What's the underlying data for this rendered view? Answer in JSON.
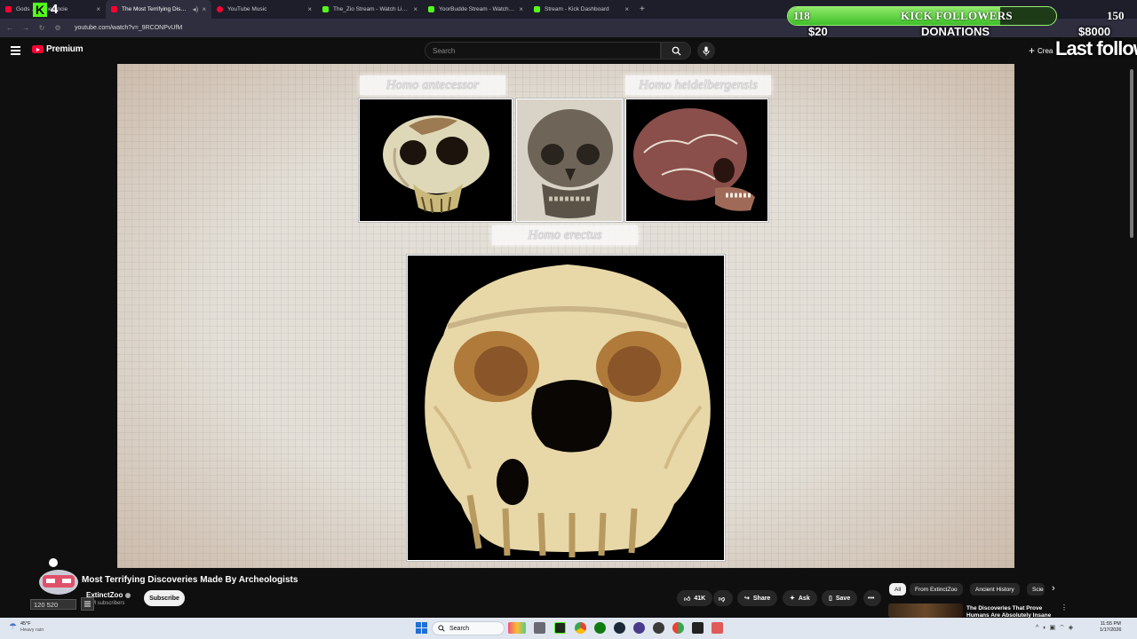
{
  "browser": {
    "tabs": [
      {
        "label": "Gods ... in the Ancie",
        "favicon_color": "#ff0033",
        "active": false
      },
      {
        "label": "The Most Terrifying Discov",
        "favicon_color": "#ff0033",
        "active": true
      },
      {
        "label": "YouTube Music",
        "favicon_color": "#ff0033",
        "active": false
      },
      {
        "label": "The_Zio Stream - Watch Live o",
        "favicon_color": "#53fc18",
        "active": false
      },
      {
        "label": "YoorBudde Stream - Watch Live",
        "favicon_color": "#53fc18",
        "active": false
      },
      {
        "label": "Stream - Kick Dashboard",
        "favicon_color": "#53fc18",
        "active": false
      }
    ],
    "url": "youtube.com/watch?v=_9RCONPvUfM"
  },
  "masthead": {
    "logo_text": "Premium",
    "search_placeholder": "Search",
    "create_label": "Crea"
  },
  "video_frame": {
    "labels": {
      "antecessor": "Homo antecessor",
      "heidelbergensis": "Homo heidelbergensis",
      "erectus": "Homo erectus"
    }
  },
  "video_info": {
    "title": "Most Terrifying Discoveries Made By Archeologists",
    "channel": "ExtinctZoo",
    "subscribers": "M subscribers",
    "subscribe_label": "Subscribe",
    "likes": "41K",
    "share_label": "Share",
    "ask_label": "Ask",
    "save_label": "Save",
    "chips": [
      "All",
      "From ExtinctZoo",
      "Ancient History",
      "Scie"
    ],
    "recommended_title": "The Discoveries That Prove Humans Are Absolutely Insane"
  },
  "stream_overlay": {
    "followers_current": "118",
    "followers_goal": "150",
    "followers_label": "KICK FOLLOWERS",
    "followers_progress": 0.79,
    "donations_current": "$20",
    "donations_label": "DONATIONS",
    "donations_goal": "$8000",
    "last_follower_label": "Last followe",
    "kick_counter": "4",
    "viewer_count": "120 520",
    "accent": "#53fc18"
  },
  "taskbar": {
    "weather_temp": "45°F",
    "weather_desc": "Heavy rain",
    "search_label": "Search",
    "time": "11:55 PM",
    "date": "1/17/2026"
  }
}
